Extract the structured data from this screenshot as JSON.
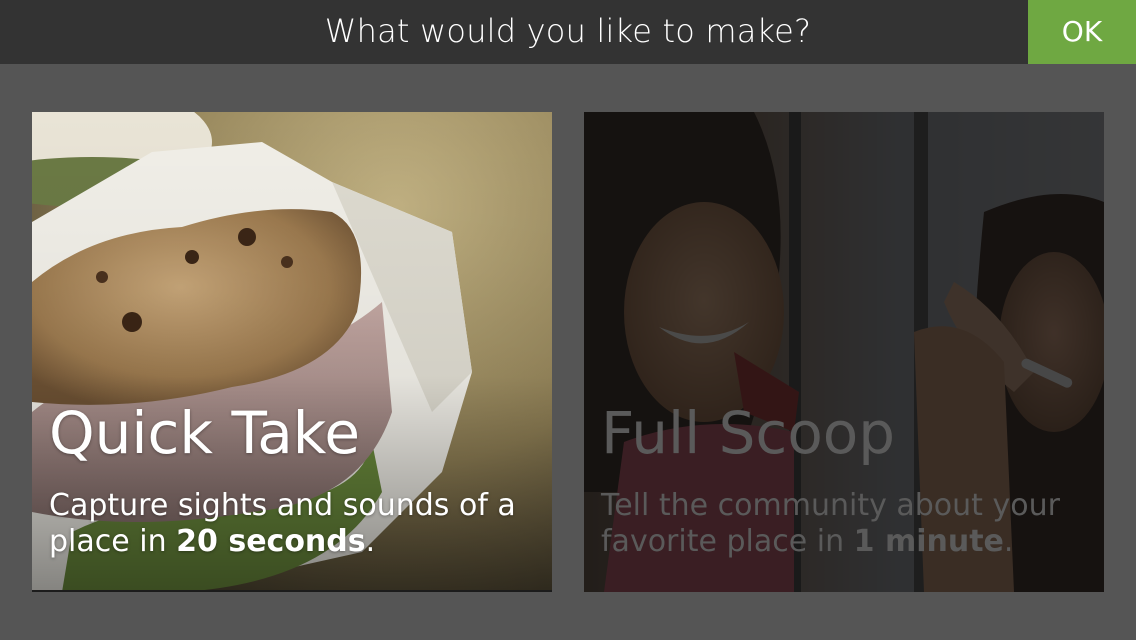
{
  "header": {
    "title": "What would you like to make?",
    "ok_label": "OK"
  },
  "options": [
    {
      "title": "Quick Take",
      "desc_prefix": "Capture sights and sounds of a place in ",
      "desc_bold": "20 seconds",
      "desc_suffix": ".",
      "selected": true
    },
    {
      "title": "Full Scoop",
      "desc_prefix": "Tell the community about your favorite place in ",
      "desc_bold": "1 minute",
      "desc_suffix": ".",
      "selected": false
    }
  ],
  "colors": {
    "topbar": "#333333",
    "background": "#555555",
    "ok_button": "#6fa842"
  }
}
